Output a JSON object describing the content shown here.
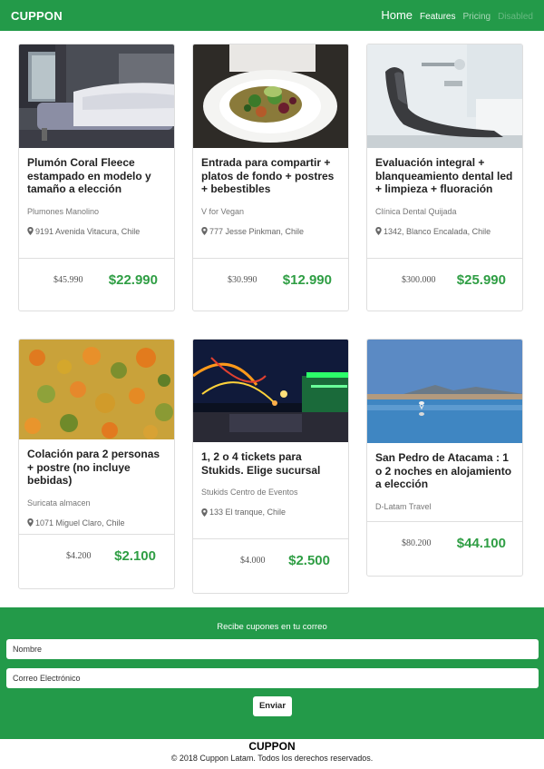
{
  "navbar": {
    "brand": "CUPPON",
    "links": [
      "Home",
      "Features",
      "Pricing",
      "Disabled"
    ]
  },
  "deals": [
    {
      "title": "Plumón Coral Fleece estampado en modelo y tamaño a elección",
      "merchant": "Plumones Manolino",
      "location": "9191 Avenida Vitacura, Chile",
      "old_price": "$45.990",
      "new_price": "$22.990",
      "image": "bedroom"
    },
    {
      "title": "Entrada para compartir + platos de fondo + postres + bebestibles",
      "merchant": "V for Vegan",
      "location": "777 Jesse Pinkman, Chile",
      "old_price": "$30.990",
      "new_price": "$12.990",
      "image": "salad-plate"
    },
    {
      "title": "Evaluación integral + blanqueamiento dental led + limpieza + fluoración",
      "merchant": "Clínica Dental Quijada",
      "location": "1342, Blanco Encalada, Chile",
      "old_price": "$300.000",
      "new_price": "$25.990",
      "image": "dental-chair"
    },
    {
      "title": "Colación para 2 personas + postre (no incluye bebidas)",
      "merchant": "Suricata almacen",
      "location": "1071 Miguel Claro, Chile",
      "old_price": "$4.200",
      "new_price": "$2.100",
      "image": "food-dish"
    },
    {
      "title": "1, 2 o 4 tickets para Stukids. Elige sucursal",
      "merchant": "Stukids Centro de Eventos",
      "location": "133 El tranque, Chile",
      "old_price": "$4.000",
      "new_price": "$2.500",
      "image": "amusement-park"
    },
    {
      "title": "San Pedro de Atacama : 1 o 2 noches en alojamiento a elección",
      "merchant": "D-Latam Travel",
      "location": "",
      "old_price": "$80.200",
      "new_price": "$44.100",
      "image": "salt-lake-flamingo"
    }
  ],
  "newsletter": {
    "title": "Recibe cupones en tu correo",
    "name_placeholder": "Nombre",
    "email_placeholder": "Correo Electrónico",
    "submit_label": "Enviar"
  },
  "footer": {
    "brand": "CUPPON",
    "copyright": "© 2018 Cuppon Latam. Todos los derechos reservados."
  },
  "colors": {
    "primary": "#239a49",
    "price": "#2f9e44"
  }
}
